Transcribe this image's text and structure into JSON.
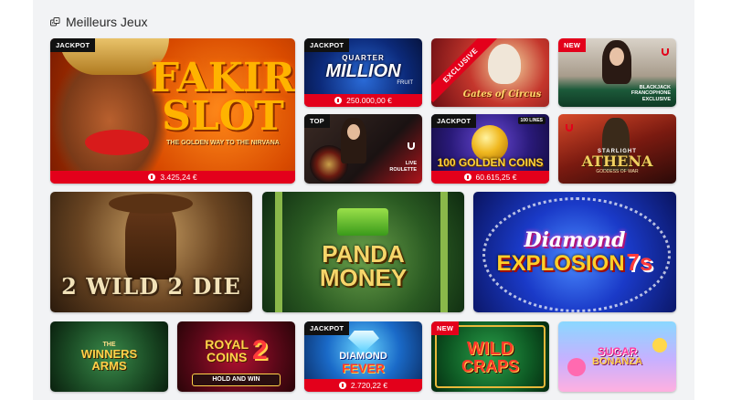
{
  "section": {
    "title": "Meilleurs Jeux",
    "icon": "dice-icon"
  },
  "colors": {
    "accent": "#e3001b",
    "panel": "#f2f3f5"
  },
  "games": {
    "fakir": {
      "badge": "JACKPOT",
      "title_line1": "FAKIR",
      "title_line2": "SLOT",
      "tagline": "THE GOLDEN WAY TO THE NIRVANA",
      "jackpot": "3.425,24 €"
    },
    "quarter_million": {
      "badge": "JACKPOT",
      "title_top": "QUARTER",
      "title_main": "MILLION",
      "title_sub": "FRUIT",
      "jackpot": "250.000,00 €"
    },
    "gates_of_circus": {
      "ribbon": "EXCLUSIVE",
      "title": "Gates of Circus"
    },
    "blackjack": {
      "badge": "NEW",
      "caption": "BLACKJACK FRANCOPHONE EXCLUSIVE"
    },
    "live_roulette": {
      "badge": "TOP",
      "caption": "LIVE ROULETTE"
    },
    "golden_coins": {
      "badge": "JACKPOT",
      "lines": "100 LINES",
      "title": "100 GOLDEN COINS",
      "jackpot": "60.615,25 €"
    },
    "athena": {
      "title_top": "STARLIGHT",
      "title_main": "ATHENA",
      "title_sub": "GODDESS OF WAR"
    },
    "wild_die": {
      "title": "2 WILD 2 DIE"
    },
    "panda_money": {
      "title_line1": "PANDA",
      "title_line2": "MONEY"
    },
    "diamond_explosion": {
      "title_line1": "Diamond",
      "title_line2": "EXPLOSION",
      "title_suffix": "7s"
    },
    "winners_arms": {
      "title_top": "THE",
      "title_main": "WINNERS ARMS"
    },
    "royal_coins": {
      "title_line1": "ROYAL",
      "title_line2": "COINS",
      "number": "2",
      "subtitle": "HOLD AND WIN"
    },
    "diamond_fever": {
      "badge": "JACKPOT",
      "title_line1": "DIAMOND",
      "title_line2": "FEVER",
      "jackpot": "2.720,22 €"
    },
    "wild_craps": {
      "badge": "NEW",
      "title_line1": "WILD",
      "title_line2": "CRAPS"
    },
    "sugar_bonanza": {
      "title_line1": "SUGAR",
      "title_line2": "BONANZA"
    }
  }
}
